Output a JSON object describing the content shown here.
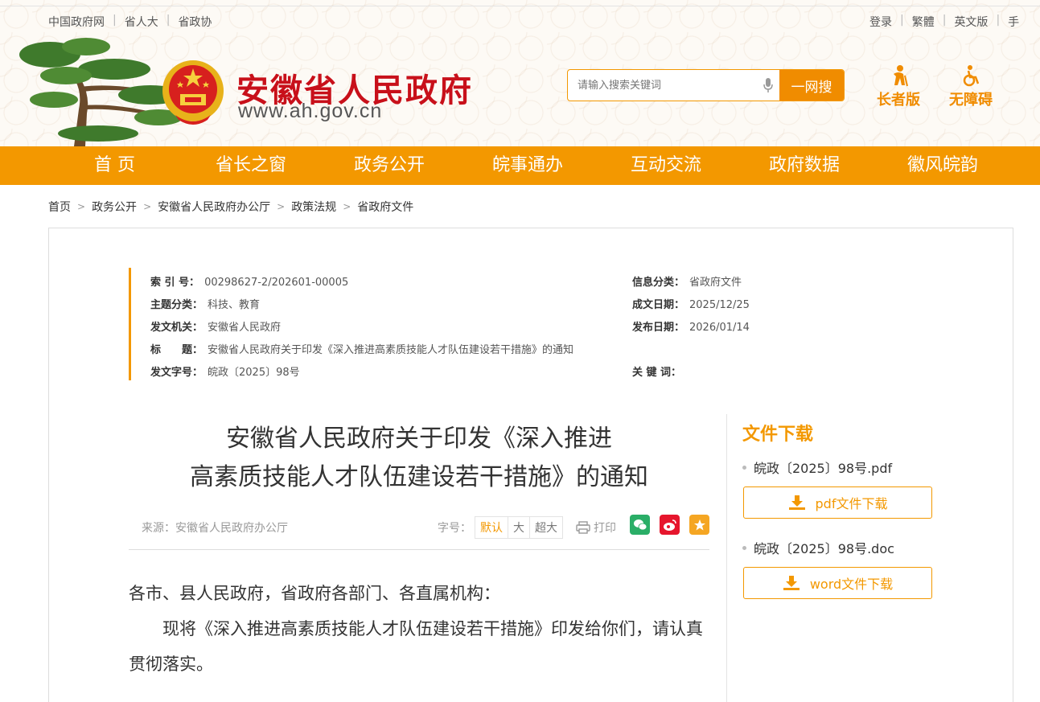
{
  "top_links_left": [
    "中国政府网",
    "省人大",
    "省政协"
  ],
  "top_links_right": [
    "登录",
    "繁體",
    "英文版",
    "手"
  ],
  "site": {
    "title": "安徽省人民政府",
    "url": "www.ah.gov.cn"
  },
  "search": {
    "placeholder": "请输入搜索关键词",
    "button": "一网搜"
  },
  "modes": {
    "elder": "长者版",
    "accessible": "无障碍"
  },
  "nav": [
    "首 页",
    "省长之窗",
    "政务公开",
    "皖事通办",
    "互动交流",
    "政府数据",
    "徽风皖韵"
  ],
  "breadcrumb": [
    "首页",
    "政务公开",
    "安徽省人民政府办公厅",
    "政策法规",
    "省政府文件"
  ],
  "meta": {
    "index_label": "索 引 号：",
    "index_value": "00298627-2/202601-00005",
    "category_label": "信息分类：",
    "category_value": "省政府文件",
    "topic_label": "主题分类：",
    "topic_value": "科技、教育",
    "created_label": "成文日期：",
    "created_value": "2025/12/25",
    "issuer_label": "发文机关：",
    "issuer_value": "安徽省人民政府",
    "published_label": "发布日期：",
    "published_value": "2026/01/14",
    "title_label": "标　　题：",
    "title_value": "安徽省人民政府关于印发《深入推进高素质技能人才队伍建设若干措施》的通知",
    "docno_label": "发文字号：",
    "docno_value": "皖政〔2025〕98号",
    "keywords_label": "关 键 词："
  },
  "article": {
    "title_line1": "安徽省人民政府关于印发《深入推进",
    "title_line2": "高素质技能人才队伍建设若干措施》的通知",
    "source": "来源：安徽省人民政府办公厅",
    "fontsize_label": "字号：",
    "fontsize_options": [
      "默认",
      "大",
      "超大"
    ],
    "print": "打印",
    "salutation": "各市、县人民政府，省政府各部门、各直属机构：",
    "paragraph1": "现将《深入推进高素质技能人才队伍建设若干措施》印发给你们，请认真贯彻落实。"
  },
  "downloads": {
    "title": "文件下载",
    "files": [
      {
        "name": "皖政〔2025〕98号.pdf",
        "button": "pdf文件下载"
      },
      {
        "name": "皖政〔2025〕98号.doc",
        "button": "word文件下载"
      }
    ]
  },
  "colors": {
    "accent": "#f39800",
    "title_red": "#c8101a",
    "wechat": "#2aae67",
    "weibo": "#e6162d",
    "favorite": "#f5a623"
  }
}
